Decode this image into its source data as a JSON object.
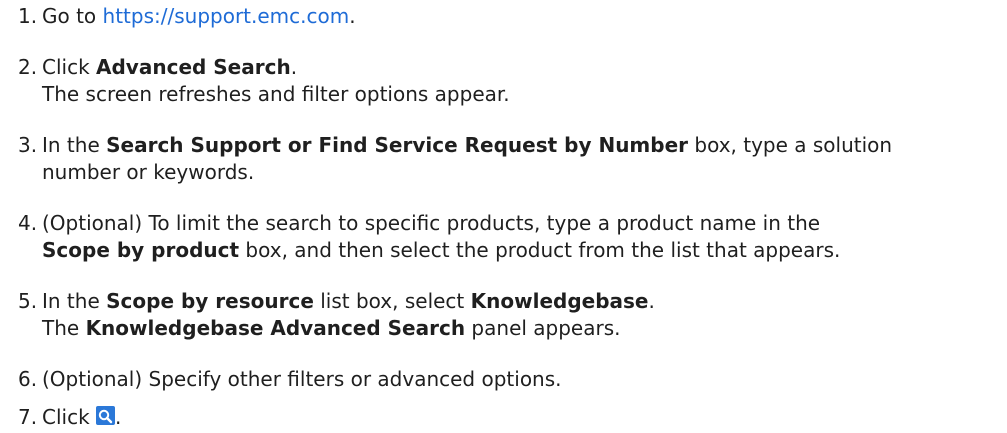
{
  "steps": [
    {
      "n": "1.",
      "pre": "Go to ",
      "link": "https://support.emc.com",
      "post": "."
    },
    {
      "n": "2.",
      "pre": "Click ",
      "b1": "Advanced Search",
      "post": ".",
      "line2": "The screen refreshes and filter options appear."
    },
    {
      "n": "3.",
      "pre": "In the ",
      "b1": "Search Support or Find Service Request by Number",
      "post": " box, type a solution",
      "line2": "number or keywords."
    },
    {
      "n": "4.",
      "pre": "(Optional) To limit the search to specific products, type a product name in the",
      "b2": "Scope by product",
      "post2": " box, and then select the product from the list that appears."
    },
    {
      "n": "5.",
      "pre": "In the ",
      "b1": "Scope by resource",
      "mid": " list box, select ",
      "b1b": "Knowledgebase",
      "post": ".",
      "l2pre": "The ",
      "b2": "Knowledgebase Advanced Search",
      "post2": " panel appears."
    },
    {
      "n": "6.",
      "pre": "(Optional) Specify other filters or advanced options."
    },
    {
      "n": "7.",
      "pre": "Click ",
      "post": ".",
      "icon": "search-icon",
      "icon_color": "#2b78d8"
    }
  ]
}
